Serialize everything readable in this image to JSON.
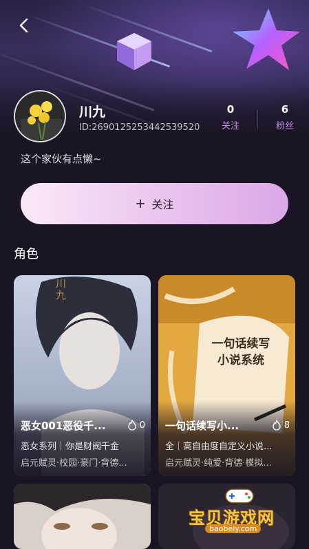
{
  "profile": {
    "nickname": "川九",
    "id_text": "ID:2690125253442539520",
    "bio": "这个家伙有点懒~",
    "stats": [
      {
        "value": "0",
        "label": "关注"
      },
      {
        "value": "6",
        "label": "粉丝"
      }
    ]
  },
  "follow_button": {
    "icon": "plus-icon",
    "label": "关注"
  },
  "section": {
    "title": "角色"
  },
  "cards": [
    {
      "name": "恶女001恶役千...",
      "heat": "0",
      "desc": "恶女系列｜你是财阀千金",
      "tags": "启元赋灵·校园·豪门·背德...",
      "art_text": "川九"
    },
    {
      "name": "一句话续写小...",
      "heat": "8",
      "desc": "全｜高自由度自定义小说...",
      "tags": "启元赋灵·纯爱·背德·模拟...",
      "art_text": "一句话续写小说系统"
    }
  ],
  "watermark": {
    "title": "宝贝游戏网",
    "url": "baobeiy.com"
  },
  "colors": {
    "accent": "#c48de6",
    "background": "#1a1524",
    "button_start": "#fbe9f7",
    "button_end": "#dba7e8"
  }
}
